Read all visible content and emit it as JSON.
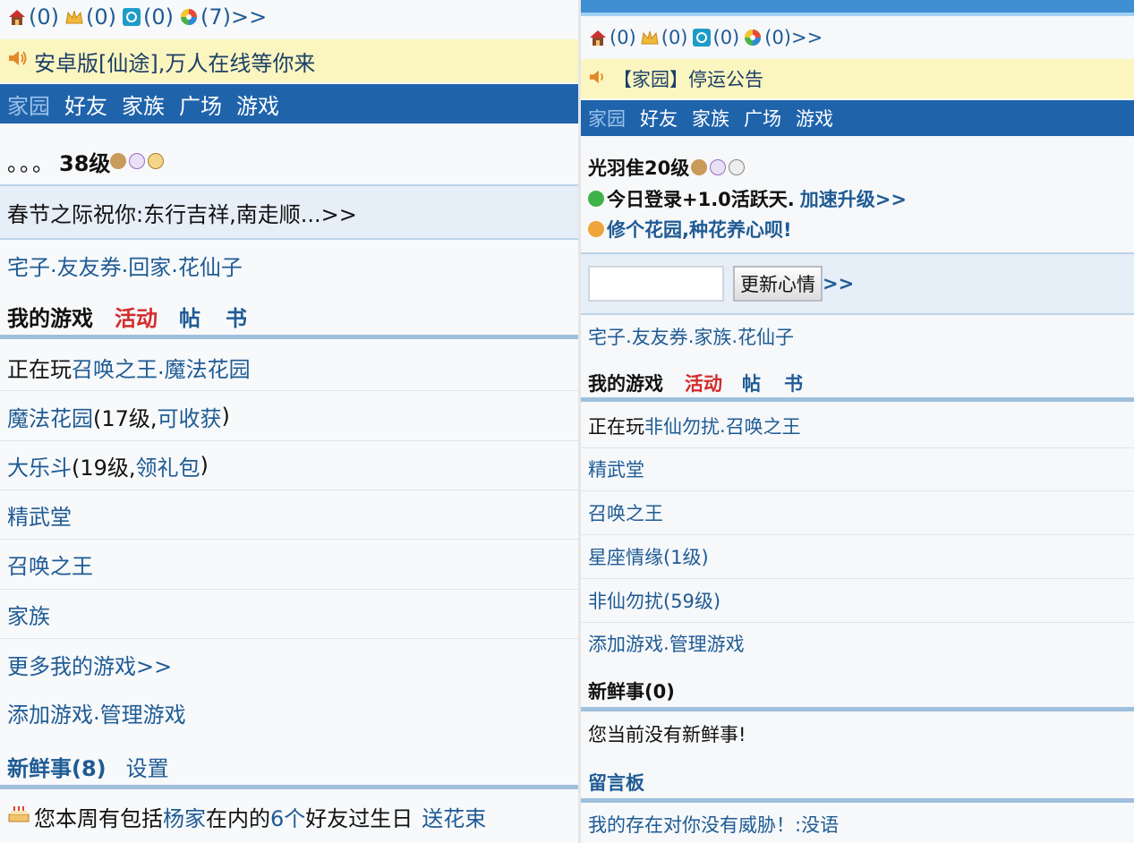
{
  "left": {
    "counters": [
      {
        "icon": "house-icon",
        "value": "(0)"
      },
      {
        "icon": "crown-icon",
        "value": "(0)"
      },
      {
        "icon": "chat-icon",
        "value": "(0)"
      },
      {
        "icon": "color-ball-icon",
        "value": "(7)>>"
      }
    ],
    "notice": "安卓版[仙途],万人在线等你来",
    "nav": [
      "家园",
      "好友",
      "家族",
      "广场",
      "游戏"
    ],
    "user_prefix": "。。。",
    "user_level": "38级",
    "greeting": "春节之际祝你:东行吉祥,南走顺...>>",
    "links": {
      "a": "宅子",
      "b": "友友券",
      "c": "回家",
      "d": "花仙子",
      "sep": "."
    },
    "tabs": {
      "my_games": "我的游戏",
      "activity": "活动",
      "posts": "帖",
      "book": "书"
    },
    "playing": {
      "prefix": "正在玩",
      "game1": "召唤之王",
      "sep": ".",
      "game2": "魔法花园"
    },
    "games": [
      {
        "name": "魔法花园",
        "open": "(17级,",
        "extra": "可收获",
        "close": ")"
      },
      {
        "name": "大乐斗",
        "open": "(19级,",
        "extra": "领礼包",
        "close": ")"
      },
      {
        "name": "精武堂"
      },
      {
        "name": "召唤之王"
      },
      {
        "name": "家族"
      },
      {
        "name": "更多我的游戏>>"
      }
    ],
    "manage": {
      "add": "添加游戏",
      "sep": ".",
      "manage": "管理游戏"
    },
    "news": {
      "label": "新鲜事(8)",
      "settings": "设置"
    },
    "birthday": {
      "p1": "您本周有包括",
      "name": "杨家",
      "p2": "在内的",
      "count": "6个",
      "p3": "好友过生日",
      "action": "送花束"
    }
  },
  "right": {
    "counters": [
      {
        "icon": "house-icon",
        "value": "(0)"
      },
      {
        "icon": "crown-icon",
        "value": "(0)"
      },
      {
        "icon": "chat-icon",
        "value": "(0)"
      },
      {
        "icon": "color-ball-icon",
        "value": "(0)>>"
      }
    ],
    "notice": "【家园】停运公告",
    "nav": [
      "家园",
      "好友",
      "家族",
      "广场",
      "游戏"
    ],
    "user": "光羽隹20级",
    "login": {
      "text": "今日登录+1.0活跃天.",
      "link": "加速升级>>"
    },
    "garden": "修个花园,种花养心呗!",
    "mood_input": {
      "value": "",
      "placeholder": ""
    },
    "mood_button": "更新心情",
    "mood_more": ">>",
    "links": {
      "a": "宅子",
      "b": "友友券",
      "c": "家族",
      "d": "花仙子",
      "sep": "."
    },
    "tabs": {
      "my_games": "我的游戏",
      "activity": "活动",
      "posts": "帖",
      "book": "书"
    },
    "playing": {
      "prefix": "正在玩",
      "game1": "非仙勿扰",
      "sep": ".",
      "game2": "召唤之王"
    },
    "games": [
      "精武堂",
      "召唤之王",
      "星座情缘(1级)",
      "非仙勿扰(59级)"
    ],
    "manage": {
      "add": "添加游戏",
      "sep": ".",
      "manage": "管理游戏"
    },
    "news_label": "新鲜事(0)",
    "no_news": "您当前没有新鲜事!",
    "board_label": "留言板",
    "board_msg": "我的存在对你没有威胁！:没语"
  }
}
